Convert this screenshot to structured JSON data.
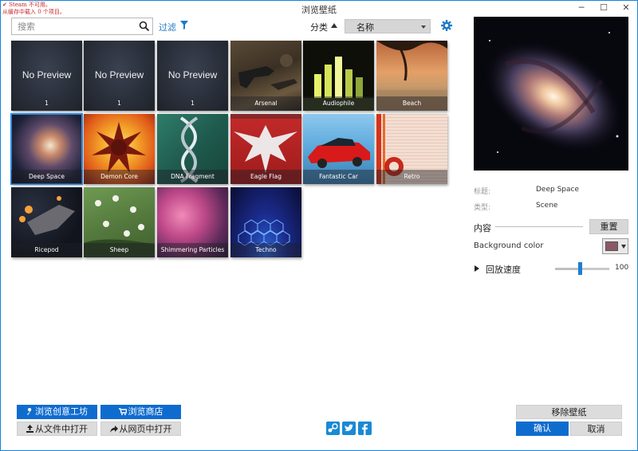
{
  "window": {
    "title": "浏览壁纸",
    "warning_line1": "Steam 不可用。",
    "warning_line2": "从缓存中载入 0 个项目。",
    "minimize": "─",
    "maximize": "☐",
    "close": "✕"
  },
  "toolbar": {
    "search_placeholder": "搜索",
    "filter_label": "过滤",
    "sort_label": "分类",
    "sort_value": "名称"
  },
  "wallpapers": [
    {
      "label": "1",
      "preview": "No Preview"
    },
    {
      "label": "1",
      "preview": "No Preview"
    },
    {
      "label": "1",
      "preview": "No Preview"
    },
    {
      "label": "Arsenal"
    },
    {
      "label": "Audiophile"
    },
    {
      "label": "Beach"
    },
    {
      "label": "Deep Space"
    },
    {
      "label": "Demon Core"
    },
    {
      "label": "DNA Fragment"
    },
    {
      "label": "Eagle Flag"
    },
    {
      "label": "Fantastic Car"
    },
    {
      "label": "Retro"
    },
    {
      "label": "Ricepod"
    },
    {
      "label": "Sheep"
    },
    {
      "label": "Shimmering Particles"
    },
    {
      "label": "Techno"
    }
  ],
  "details": {
    "title_key": "标题:",
    "title_value": "Deep Space",
    "type_key": "类型:",
    "type_value": "Scene",
    "content_label": "内容",
    "reset_button": "重置",
    "bg_color_label": "Background color",
    "bg_color": "#8a5a66",
    "speed_label": "回放速度",
    "speed_value": "100",
    "speed_fraction": 0.45
  },
  "actions": {
    "browse_workshop": "浏览创意工坊",
    "browse_store": "浏览商店",
    "open_file": "从文件中打开",
    "open_web": "从网页中打开",
    "remove_wallpaper": "移除壁纸",
    "ok": "确认",
    "cancel": "取消"
  },
  "colors": {
    "accent": "#0f6ccf",
    "link": "#1f7ac9"
  }
}
